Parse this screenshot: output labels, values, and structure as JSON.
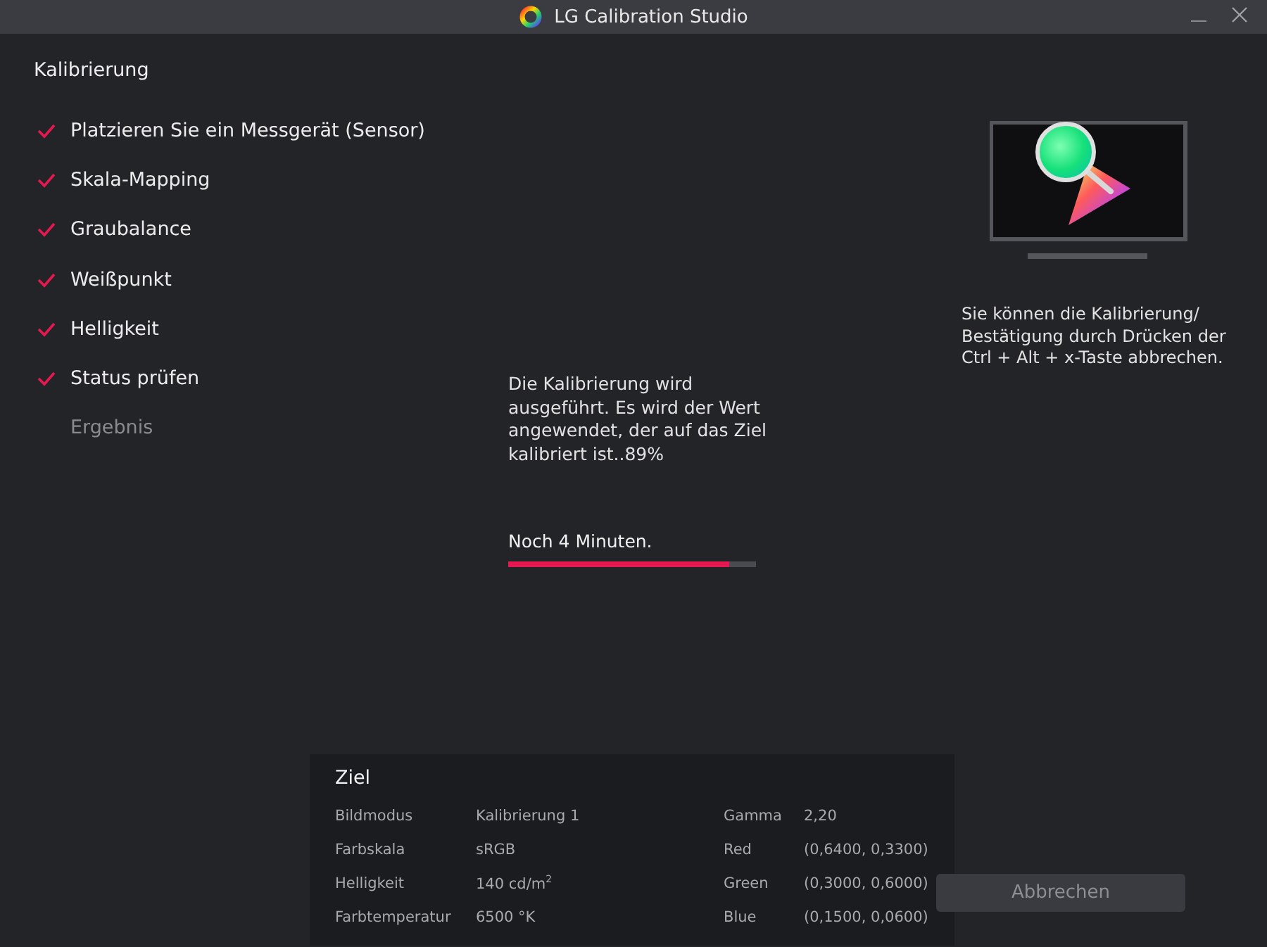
{
  "window": {
    "title": "LG Calibration Studio"
  },
  "sidebar": {
    "heading": "Kalibrierung",
    "steps": [
      {
        "label": "Platzieren Sie ein Messgerät (Sensor)",
        "done": true
      },
      {
        "label": "Skala-Mapping",
        "done": true
      },
      {
        "label": "Graubalance",
        "done": true
      },
      {
        "label": "Weißpunkt",
        "done": true
      },
      {
        "label": "Helligkeit",
        "done": true
      },
      {
        "label": "Status prüfen",
        "done": true
      },
      {
        "label": "Ergebnis",
        "done": false
      }
    ]
  },
  "progress": {
    "message": "Die Kalibrierung wird ausgeführt. Es wird der Wert angewendet, der auf das Ziel kalibriert ist..89%",
    "remaining": "Noch 4 Minuten.",
    "level": 0.89
  },
  "target": {
    "title": "Ziel",
    "rows": [
      {
        "label": "Bildmodus",
        "value": "Kalibrierung 1",
        "label_2": "Gamma",
        "value_2": "2,20"
      },
      {
        "label": "Farbskala",
        "value": "sRGB",
        "label_2": "Red",
        "value_2": "(0,6400, 0,3300)"
      },
      {
        "label": "Helligkeit",
        "value": "140  cd/m$^{2}$",
        "label_2": "Green",
        "value_2": "(0,3000, 0,6000)"
      },
      {
        "label": "Farbtemperatur",
        "value": "6500 °K",
        "label_2": "Blue",
        "value_2": "(0,1500, 0,0600)"
      }
    ]
  },
  "hint": "Sie können die Kalibrierung/ Bestätigung durch Drücken der Ctrl + Alt + x-Taste abbrechen.",
  "buttons": [
    "Abbrechen"
  ]
}
